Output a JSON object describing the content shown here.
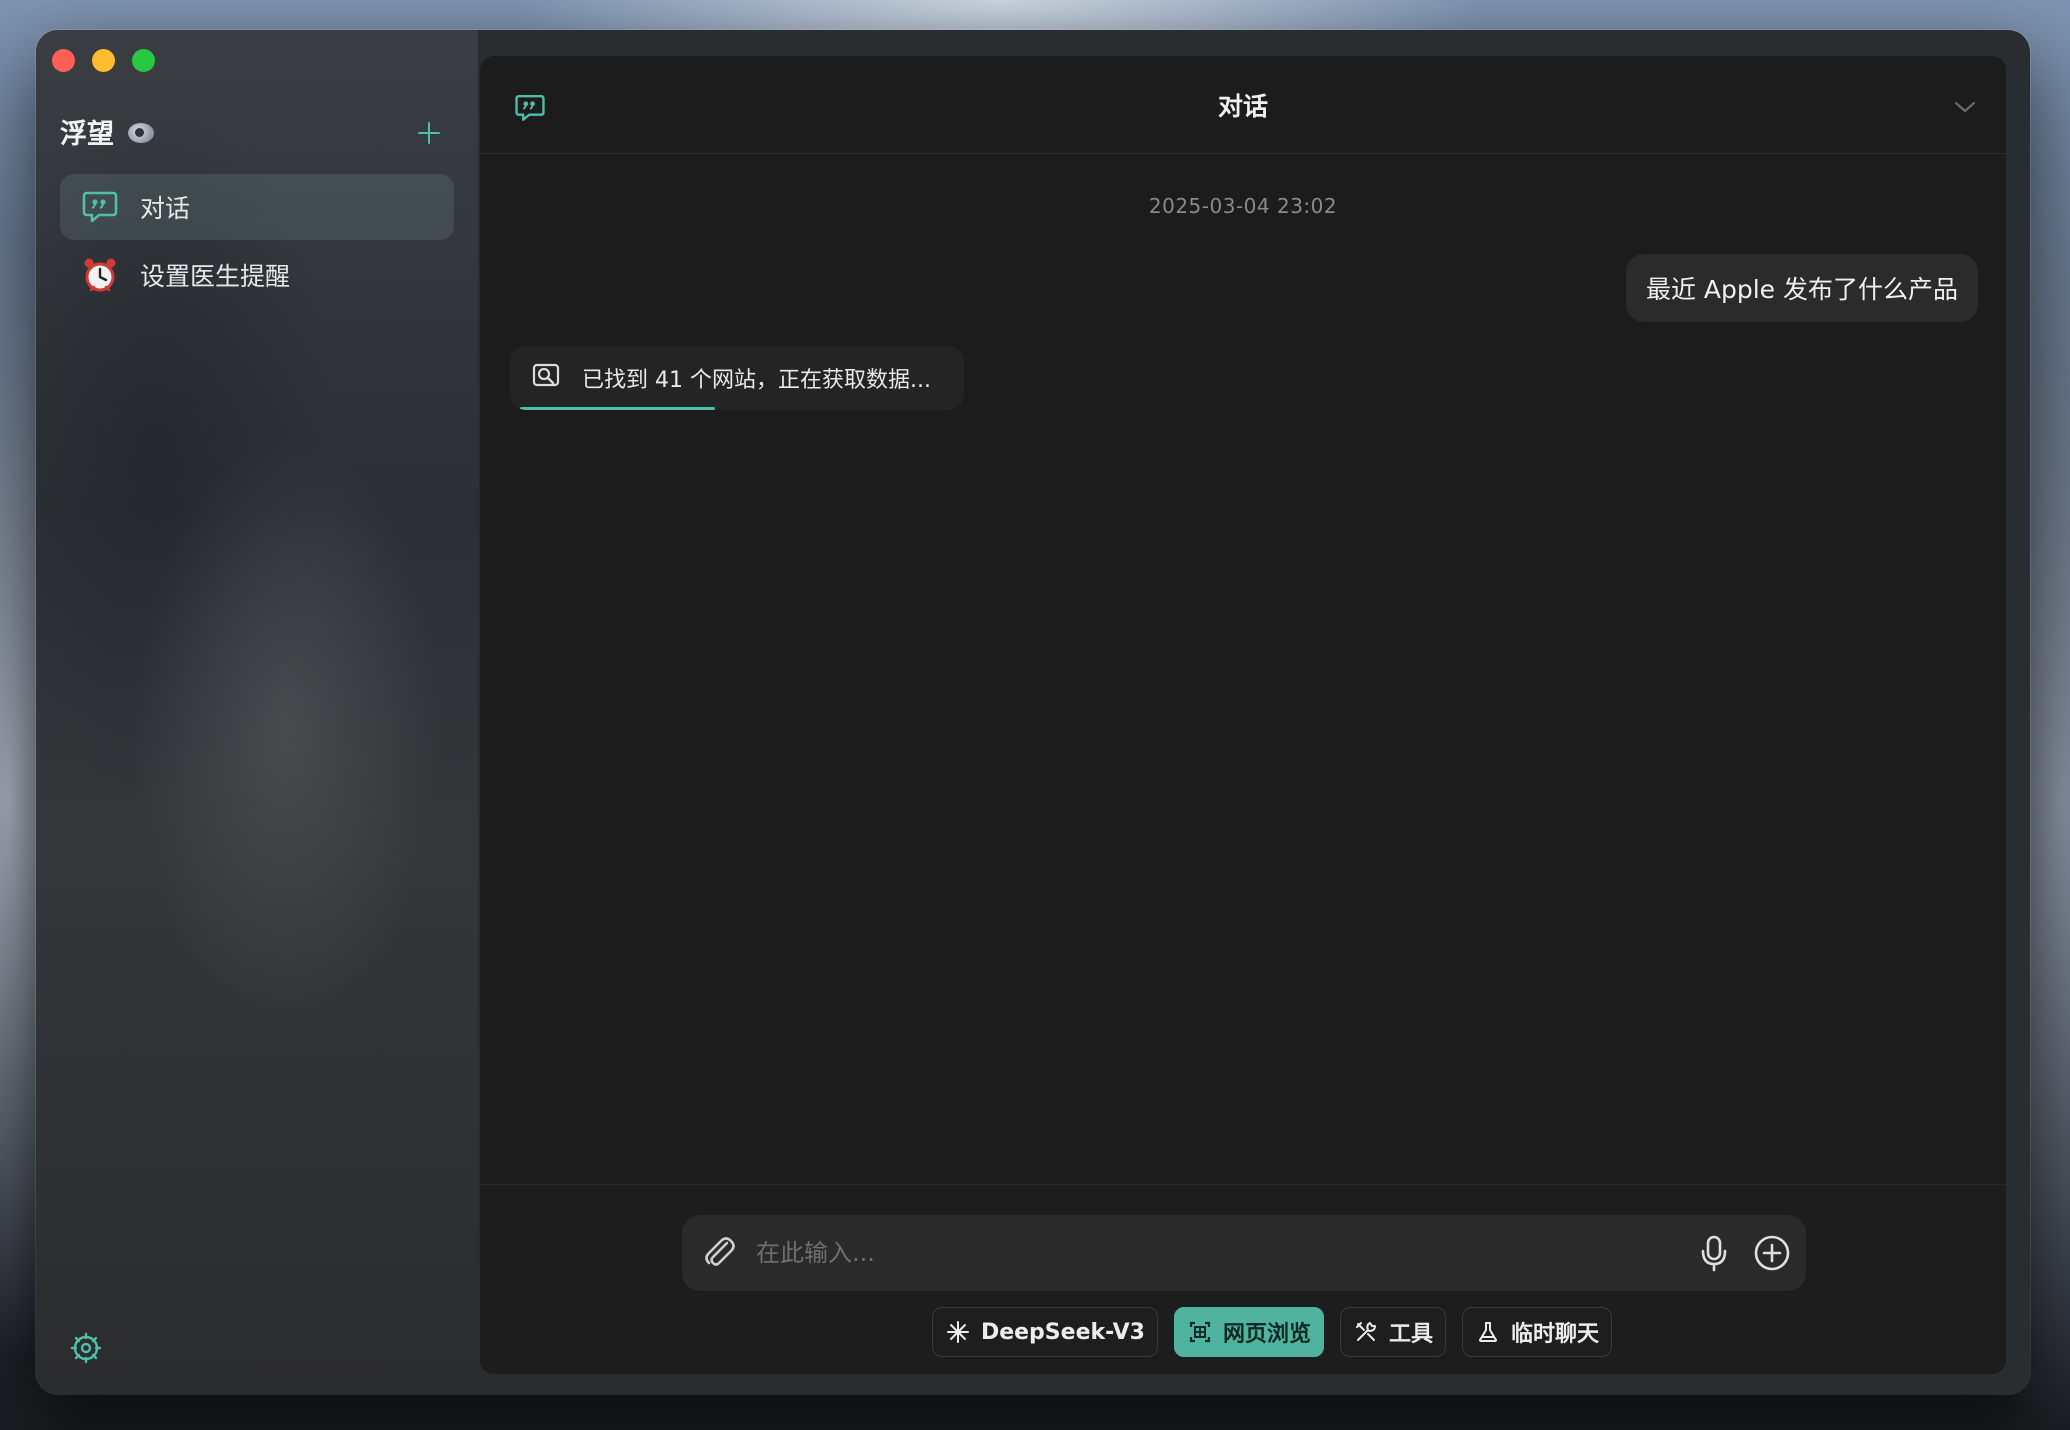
{
  "app": {
    "title": "浮望"
  },
  "sidebar": {
    "items": [
      {
        "label": "对话",
        "icon": "chat-quote-icon",
        "active": true
      },
      {
        "label": "设置医生提醒",
        "icon": "alarm-clock-icon",
        "active": false
      }
    ]
  },
  "header": {
    "title": "对话"
  },
  "conversation": {
    "timestamp": "2025-03-04 23:02",
    "user_message": "最近 Apple 发布了什么产品",
    "search_status": "已找到 41 个网站，正在获取数据...",
    "search_progress": 0.45
  },
  "composer": {
    "placeholder": "在此输入..."
  },
  "toolbar": {
    "model_label": "DeepSeek-V3",
    "web_label": "网页浏览",
    "tools_label": "工具",
    "temp_label": "临时聊天"
  },
  "colors": {
    "accent": "#4fbfa8",
    "background": "#1c1c1c",
    "bubble": "#2b2b2b"
  }
}
